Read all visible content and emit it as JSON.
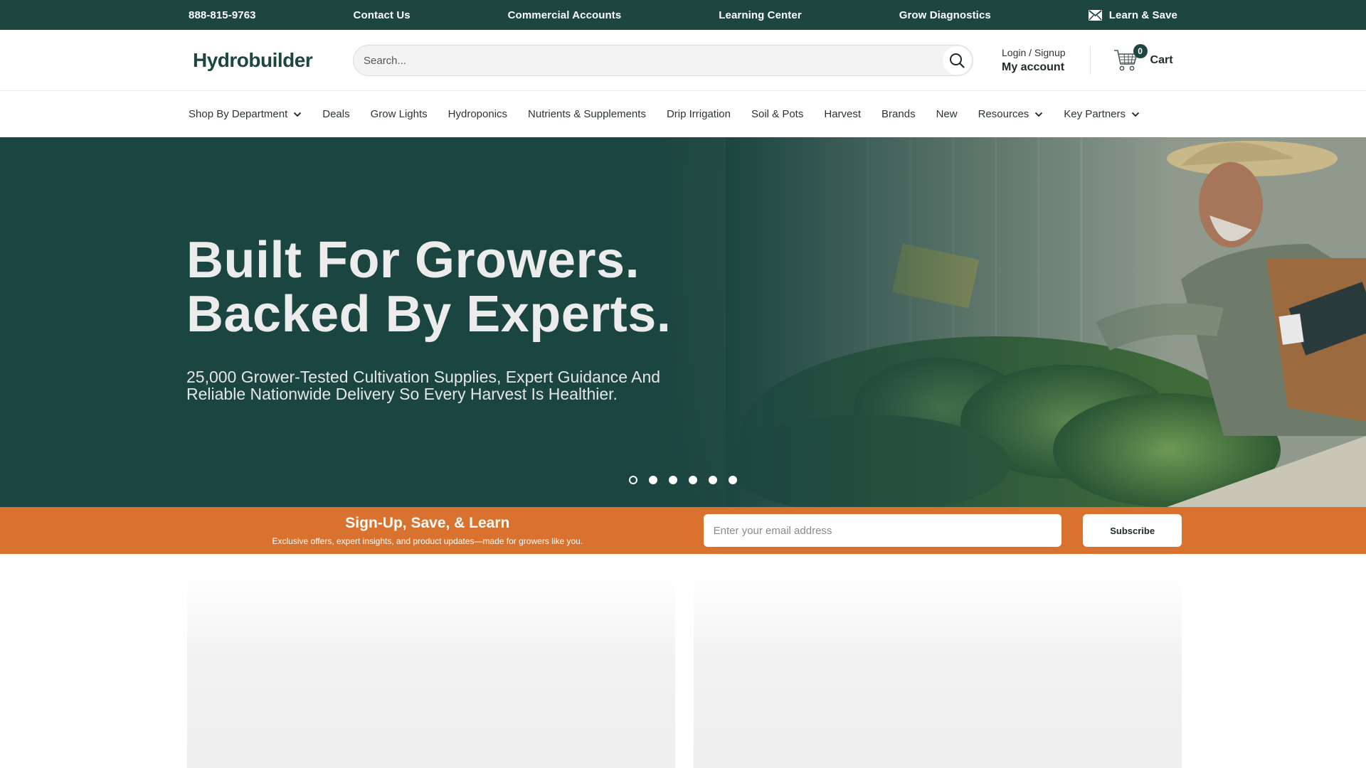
{
  "topbar": {
    "phone": "888-815-9763",
    "contact": "Contact Us",
    "commercial": "Commercial Accounts",
    "learning": "Learning Center",
    "diagnostics": "Grow Diagnostics",
    "learn_save": "Learn & Save"
  },
  "header": {
    "logo": "Hydrobuilder",
    "search_placeholder": "Search...",
    "login": "Login / Signup",
    "account": "My account",
    "cart_count": "0",
    "cart_label": "Cart"
  },
  "nav": [
    {
      "label": "Shop By Department",
      "dropdown": true
    },
    {
      "label": "Deals",
      "dropdown": false
    },
    {
      "label": "Grow Lights",
      "dropdown": false
    },
    {
      "label": "Hydroponics",
      "dropdown": false
    },
    {
      "label": "Nutrients & Supplements",
      "dropdown": false
    },
    {
      "label": "Drip Irrigation",
      "dropdown": false
    },
    {
      "label": "Soil & Pots",
      "dropdown": false
    },
    {
      "label": "Harvest",
      "dropdown": false
    },
    {
      "label": "Brands",
      "dropdown": false
    },
    {
      "label": "New",
      "dropdown": false
    },
    {
      "label": "Resources",
      "dropdown": true
    },
    {
      "label": "Key Partners",
      "dropdown": true
    }
  ],
  "hero": {
    "title_line1": "Built For Growers.",
    "title_line2": "Backed By Experts.",
    "subtitle_line1": "25,000 Grower-Tested Cultivation Supplies, Expert Guidance And",
    "subtitle_line2": "Reliable Nationwide Delivery So Every Harvest Is Healthier.",
    "slide_count": 6,
    "active_slide": 1
  },
  "signup": {
    "title": "Sign-Up, Save, & Learn",
    "desc": "Exclusive offers, expert insights, and product updates—made for growers like you.",
    "email_placeholder": "Enter your email address",
    "button": "Subscribe"
  },
  "colors": {
    "brand_dark": "#1d4641",
    "accent_orange": "#d9722f"
  }
}
